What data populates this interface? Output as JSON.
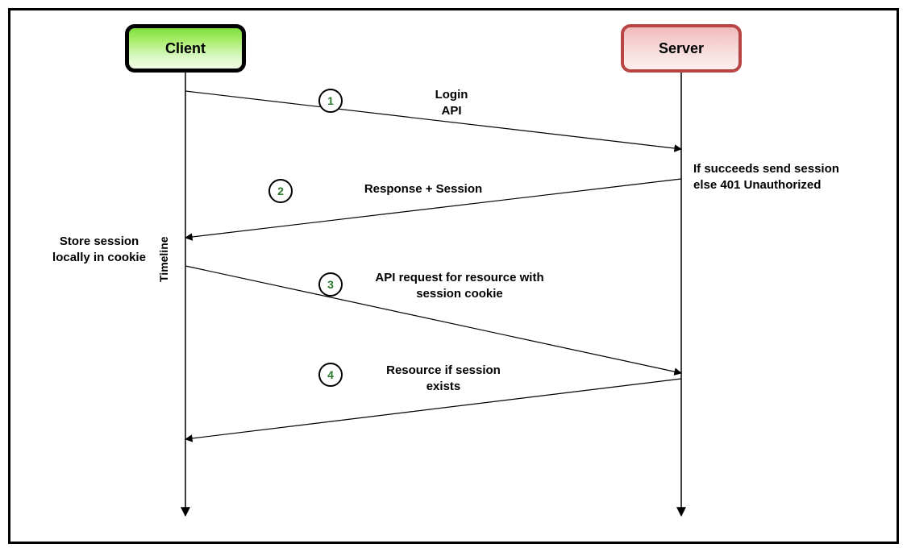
{
  "participants": {
    "client": "Client",
    "server": "Server"
  },
  "steps": {
    "s1": {
      "num": "1",
      "label": "Login\nAPI"
    },
    "s2": {
      "num": "2",
      "label": "Response + Session"
    },
    "s3": {
      "num": "3",
      "label": "API request for resource with\nsession cookie"
    },
    "s4": {
      "num": "4",
      "label": "Resource if session\nexists"
    }
  },
  "notes": {
    "server_note": "If succeeds send session\nelse 401 Unauthorized",
    "client_note": "Store session\nlocally in cookie",
    "timeline": "Timeline"
  }
}
